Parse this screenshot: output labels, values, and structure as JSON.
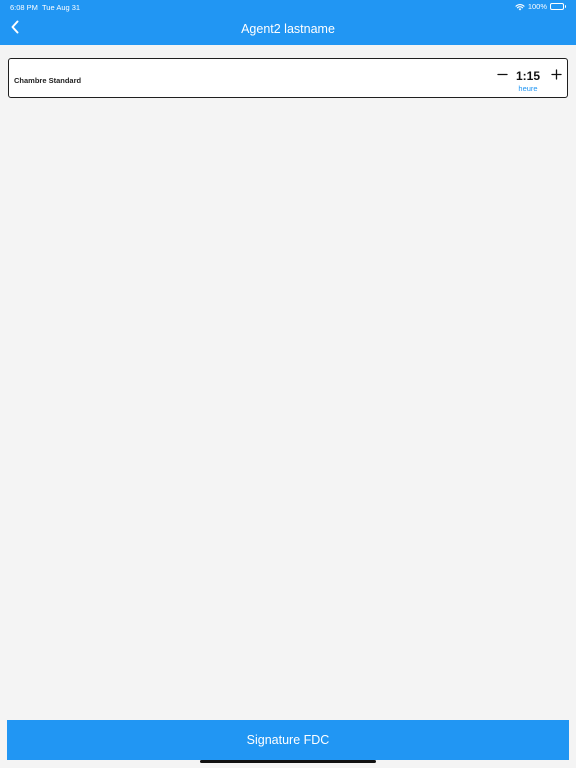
{
  "status_bar": {
    "time": "6:08 PM",
    "date": "Tue Aug 31",
    "battery": "100%",
    "icons": [
      "wifi-icon",
      "battery-icon"
    ]
  },
  "header": {
    "title": "Agent2 lastname",
    "back_icon": "chevron-left-icon"
  },
  "room": {
    "name": "Chambre Standard",
    "duration": "1:15",
    "unit": "heure",
    "decrement_icon": "minus-icon",
    "increment_icon": "plus-icon"
  },
  "footer": {
    "signature_label": "Signature FDC"
  },
  "colors": {
    "accent": "#2196f3",
    "background": "#f4f4f4",
    "card_border": "#1f1f1f"
  }
}
